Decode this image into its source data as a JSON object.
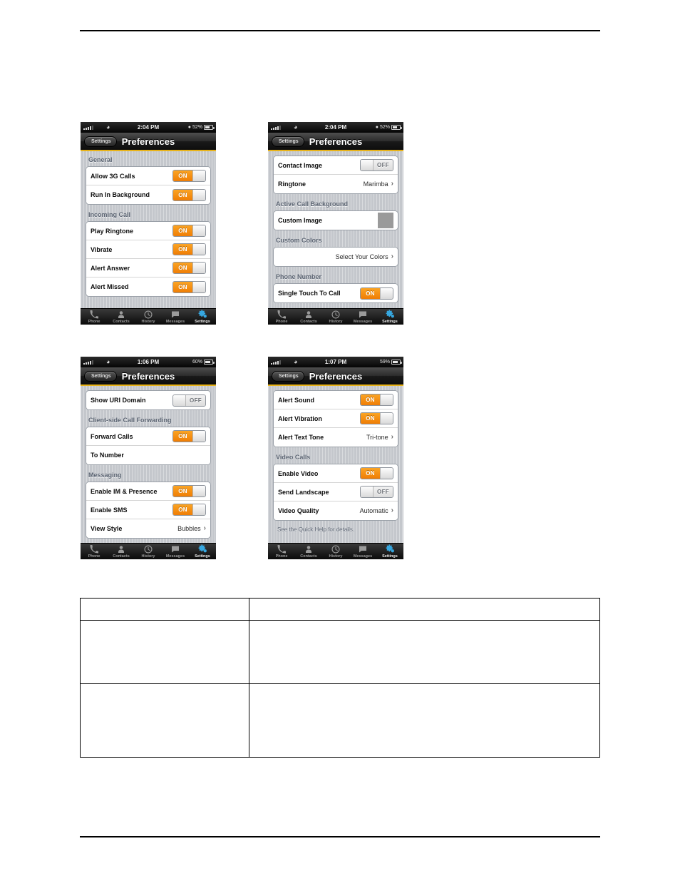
{
  "document": {
    "has_top_rule": true,
    "has_bottom_rule": true
  },
  "icons": {
    "wifi": "wifi-icon",
    "lock": "lock-icon",
    "chevron": "›"
  },
  "tabbar": {
    "items": [
      {
        "label": "Phone",
        "icon": "phone-icon",
        "active": false
      },
      {
        "label": "Contacts",
        "icon": "contacts-icon",
        "active": false
      },
      {
        "label": "History",
        "icon": "history-clock-icon",
        "active": false
      },
      {
        "label": "Messages",
        "icon": "messages-bubble-icon",
        "active": false
      },
      {
        "label": "Settings",
        "icon": "settings-gear-icon",
        "active": true
      }
    ]
  },
  "phones": [
    {
      "id": "phone-preferences-general",
      "status": {
        "carrier": "",
        "time": "2:04 PM",
        "battery": "52%",
        "battery_pct": 52
      },
      "nav": {
        "back_label": "Settings",
        "title": "Preferences"
      },
      "sections": [
        {
          "header": "General",
          "rows": [
            {
              "label": "Allow 3G Calls",
              "control": "toggle",
              "state": "ON"
            },
            {
              "label": "Run In Background",
              "control": "toggle",
              "state": "ON"
            }
          ]
        },
        {
          "header": "Incoming Call",
          "rows": [
            {
              "label": "Play Ringtone",
              "control": "toggle",
              "state": "ON"
            },
            {
              "label": "Vibrate",
              "control": "toggle",
              "state": "ON"
            },
            {
              "label": "Alert Answer",
              "control": "toggle",
              "state": "ON"
            },
            {
              "label": "Alert Missed",
              "control": "toggle",
              "state": "ON"
            }
          ]
        }
      ]
    },
    {
      "id": "phone-preferences-contact-image",
      "status": {
        "carrier": "",
        "time": "2:04 PM",
        "battery": "52%",
        "battery_pct": 52
      },
      "nav": {
        "back_label": "Settings",
        "title": "Preferences"
      },
      "sections": [
        {
          "header": "",
          "rows": [
            {
              "label": "Contact Image",
              "control": "toggle",
              "state": "OFF"
            },
            {
              "label": "Ringtone",
              "control": "value",
              "value": "Marimba",
              "chevron": true
            }
          ]
        },
        {
          "header": "Active Call Background",
          "rows": [
            {
              "label": "Custom Image",
              "control": "thumbnail"
            }
          ]
        },
        {
          "header": "Custom Colors",
          "rows": [
            {
              "label": "",
              "control": "value",
              "value": "Select Your Colors",
              "chevron": true
            }
          ]
        },
        {
          "header": "Phone Number",
          "rows": [
            {
              "label": "Single Touch To Call",
              "control": "toggle",
              "state": "ON"
            }
          ]
        }
      ]
    },
    {
      "id": "phone-preferences-messaging",
      "status": {
        "carrier": "",
        "time": "1:06 PM",
        "battery": "60%",
        "battery_pct": 60
      },
      "nav": {
        "back_label": "Settings",
        "title": "Preferences"
      },
      "sections": [
        {
          "header": "",
          "rows": [
            {
              "label": "Show URI Domain",
              "control": "toggle",
              "state": "OFF"
            }
          ]
        },
        {
          "header": "Client-side Call Forwarding",
          "rows": [
            {
              "label": "Forward Calls",
              "control": "toggle",
              "state": "ON"
            },
            {
              "label": "To Number",
              "control": "none"
            }
          ]
        },
        {
          "header": "Messaging",
          "rows": [
            {
              "label": "Enable IM & Presence",
              "control": "toggle",
              "state": "ON"
            },
            {
              "label": "Enable SMS",
              "control": "toggle",
              "state": "ON"
            },
            {
              "label": "View Style",
              "control": "value",
              "value": "Bubbles",
              "chevron": true
            }
          ]
        }
      ]
    },
    {
      "id": "phone-preferences-video",
      "status": {
        "carrier": "",
        "time": "1:07 PM",
        "battery": "59%",
        "battery_pct": 59
      },
      "nav": {
        "back_label": "Settings",
        "title": "Preferences"
      },
      "sections": [
        {
          "header": "",
          "rows": [
            {
              "label": "Alert Sound",
              "control": "toggle",
              "state": "ON"
            },
            {
              "label": "Alert Vibration",
              "control": "toggle",
              "state": "ON"
            },
            {
              "label": "Alert Text Tone",
              "control": "value",
              "value": "Tri-tone",
              "chevron": true
            }
          ]
        },
        {
          "header": "Video Calls",
          "rows": [
            {
              "label": "Enable Video",
              "control": "toggle",
              "state": "ON"
            },
            {
              "label": "Send Landscape",
              "control": "toggle",
              "state": "OFF"
            },
            {
              "label": "Video Quality",
              "control": "value",
              "value": "Automatic",
              "chevron": true
            }
          ]
        }
      ],
      "footnote": "See the Quick Help for details."
    }
  ],
  "table": {
    "rows": [
      {
        "cells": [
          "",
          ""
        ]
      },
      {
        "cells": [
          "",
          ""
        ]
      },
      {
        "cells": [
          "",
          ""
        ]
      }
    ]
  }
}
